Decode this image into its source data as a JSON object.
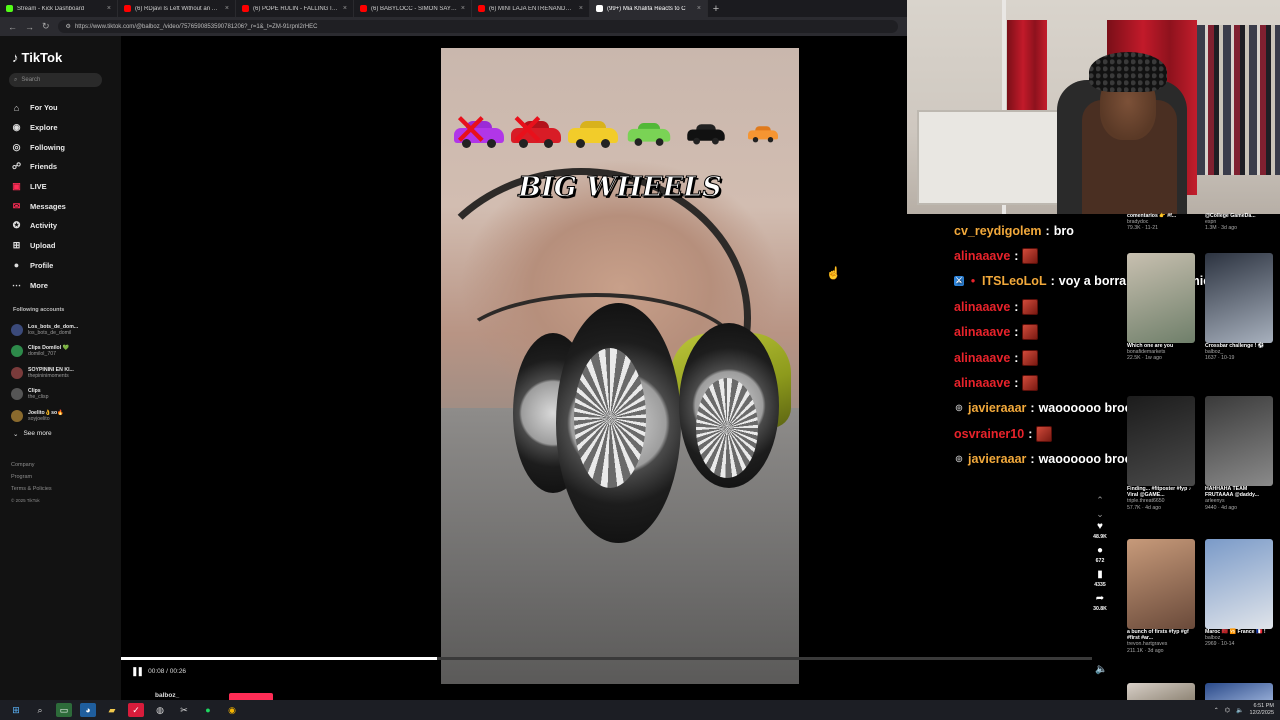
{
  "browser": {
    "tabs": [
      {
        "title": "Stream - Kick Dashboard",
        "color": "#53fc18"
      },
      {
        "title": "(6) RDjavi Is Left Without an Ans",
        "color": "#ff0000"
      },
      {
        "title": "(6) POPE RULIN - FALLING IN LOV",
        "color": "#ff0000"
      },
      {
        "title": "(6) BABYLOCC - SIMON SAYS (M",
        "color": "#ff0000"
      },
      {
        "title": "(6) MINI LAJA ENTRENANDO PAR",
        "color": "#ff0000"
      },
      {
        "title": "(99+) Mia Khalifa Reacts to C",
        "color": "#ffffff"
      }
    ],
    "url": "https://www.tiktok.com/@balboz_/video/7576590853590781206?_r=1&_t=ZM-91rpnl2rHEC"
  },
  "tiktok": {
    "logo": "TikTok",
    "search_placeholder": "Search",
    "nav": [
      {
        "label": "For You",
        "icon": "home-icon",
        "glyph": "⌂"
      },
      {
        "label": "Explore",
        "icon": "compass-icon",
        "glyph": "◉"
      },
      {
        "label": "Following",
        "icon": "following-icon",
        "glyph": "◎"
      },
      {
        "label": "Friends",
        "icon": "friends-icon",
        "glyph": "☍"
      },
      {
        "label": "LIVE",
        "icon": "live-icon",
        "glyph": "▣"
      },
      {
        "label": "Messages",
        "icon": "messages-icon",
        "glyph": "✉"
      },
      {
        "label": "Activity",
        "icon": "activity-icon",
        "glyph": "✪"
      },
      {
        "label": "Upload",
        "icon": "upload-icon",
        "glyph": "⊞"
      },
      {
        "label": "Profile",
        "icon": "profile-icon",
        "glyph": "●"
      },
      {
        "label": "More",
        "icon": "more-icon",
        "glyph": "⋯"
      }
    ],
    "following_heading": "Following accounts",
    "accounts": [
      {
        "name": "Los_bots_de_dom...",
        "handle": "los_bots_de_domil"
      },
      {
        "name": "Clips Domilol 💚",
        "handle": "domilol_707"
      },
      {
        "name": "SOYPININI EN KI...",
        "handle": "thepininimoments"
      },
      {
        "name": "Clips",
        "handle": "the_clisp"
      },
      {
        "name": "Joelito👌so🔥",
        "handle": "soyjoelito"
      }
    ],
    "see_more": "See more",
    "footer": [
      "Company",
      "Program",
      "Terms & Policies"
    ],
    "copyright": "© 2025 TikTok",
    "video": {
      "title_overlay": "BIG WHEELS",
      "time": "00:08 / 00:26",
      "progress": 0.325,
      "author": "balboz_"
    },
    "actions": [
      {
        "icon": "heart-icon",
        "glyph": "♥",
        "count": "48.9K"
      },
      {
        "icon": "comment-icon",
        "glyph": "●",
        "count": "672"
      },
      {
        "icon": "bookmark-icon",
        "glyph": "▮",
        "count": "4335"
      },
      {
        "icon": "share-icon",
        "glyph": "➦",
        "count": "30.8K"
      }
    ]
  },
  "chat": [
    {
      "user": "cv_reydigolem",
      "color": "#f2a93b",
      "text": "bro",
      "emote": false,
      "badge": ""
    },
    {
      "user": "alinaaave",
      "color": "#e8232b",
      "text": "",
      "emote": true,
      "badge": ""
    },
    {
      "user": "ITSLeoLoL",
      "color": "#f2a93b",
      "text": "voy a borrar toda esa mierda",
      "emote": false,
      "badge": "mod"
    },
    {
      "user": "alinaaave",
      "color": "#e8232b",
      "text": "",
      "emote": true,
      "badge": ""
    },
    {
      "user": "alinaaave",
      "color": "#e8232b",
      "text": "",
      "emote": true,
      "badge": ""
    },
    {
      "user": "alinaaave",
      "color": "#e8232b",
      "text": "",
      "emote": true,
      "badge": ""
    },
    {
      "user": "alinaaave",
      "color": "#e8232b",
      "text": "",
      "emote": true,
      "badge": ""
    },
    {
      "user": "javieraaar",
      "color": "#f2a93b",
      "text": "waoooooo broooooo",
      "emote": false,
      "badge": "o"
    },
    {
      "user": "osvrainer10",
      "color": "#e8232b",
      "text": "",
      "emote": true,
      "badge": ""
    },
    {
      "user": "javieraaar",
      "color": "#f2a93b",
      "text": "waoooooo broooooo",
      "emote": false,
      "badge": "o"
    }
  ],
  "suggested": [
    {
      "caption": "comentarios 👉 #f...",
      "user": "bradydoc",
      "stats": "79.3K · 11-21",
      "top": true
    },
    {
      "caption": "@College GameDa...",
      "user": "espn",
      "stats": "1.3M · 3d ago",
      "top": true
    },
    {
      "caption": "Which one are you",
      "user": "bonafidemarkets",
      "stats": "22.5K · 1w ago",
      "top": false
    },
    {
      "caption": "Crossbar challenge ! ⚽",
      "user": "balboz_",
      "stats": "1637 · 10-19",
      "top": false
    },
    {
      "caption": "Finding... #fitposter #fyp ♪ Viral @GAME...",
      "user": "triple.threat6650",
      "stats": "57.7K · 4d ago",
      "top": false
    },
    {
      "caption": "HAHHAHA TEAM FRUTAAAA @daddy...",
      "user": "arleenys",
      "stats": "9440 · 4d ago",
      "top": false
    },
    {
      "caption": "a bunch of firsts #fyp #gf #first #ar...",
      "user": "trevon.hartgraves",
      "stats": "211.1K · 3d ago",
      "top": false
    },
    {
      "caption": "Maroc 🇲🇦 🆚 France 🇫🇷 !",
      "user": "balboz_",
      "stats": "2969 · 10-14",
      "top": false
    }
  ],
  "taskbar": {
    "time": "6:51 PM",
    "date": "12/2/2025"
  }
}
